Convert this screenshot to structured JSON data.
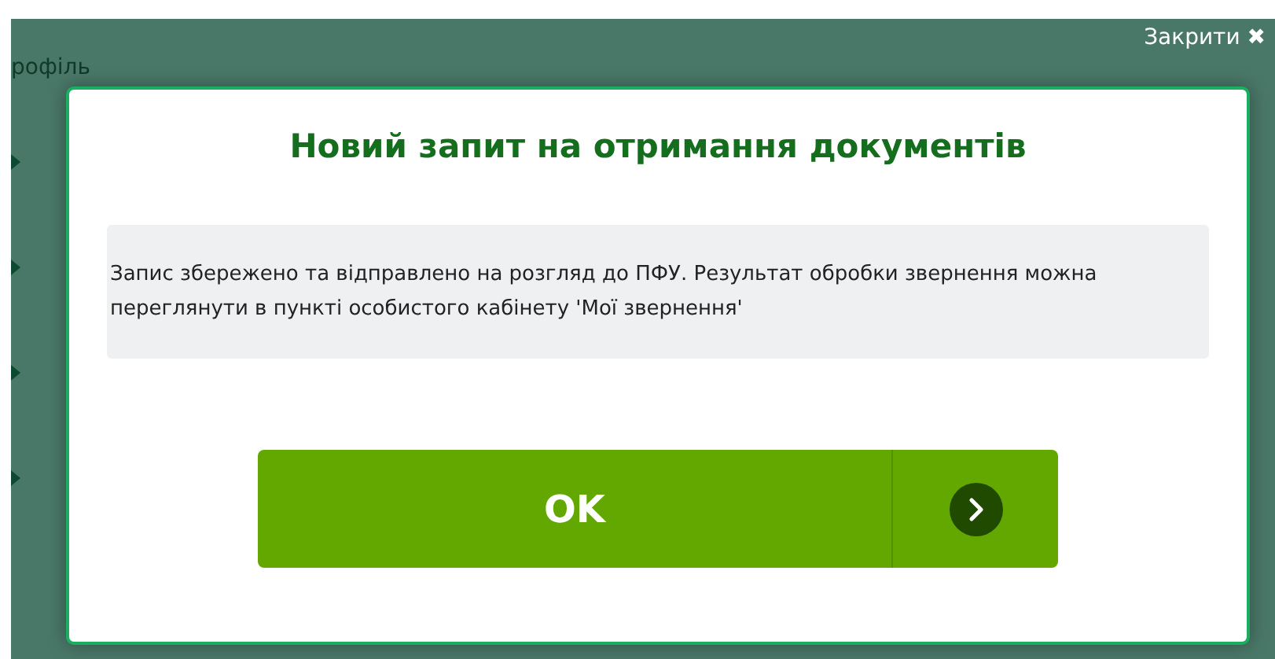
{
  "background": {
    "heading": "рофіль"
  },
  "close_button": {
    "label": "Закрити",
    "icon": "✖"
  },
  "dialog": {
    "title": "Новий запит на отримання документів",
    "message": "Запис збережено та відправлено на розгляд до ПФУ. Результат обробки звернення можна переглянути в пункті особистого кабінету 'Мої звернення'",
    "ok_button": {
      "label": "OK"
    }
  }
}
